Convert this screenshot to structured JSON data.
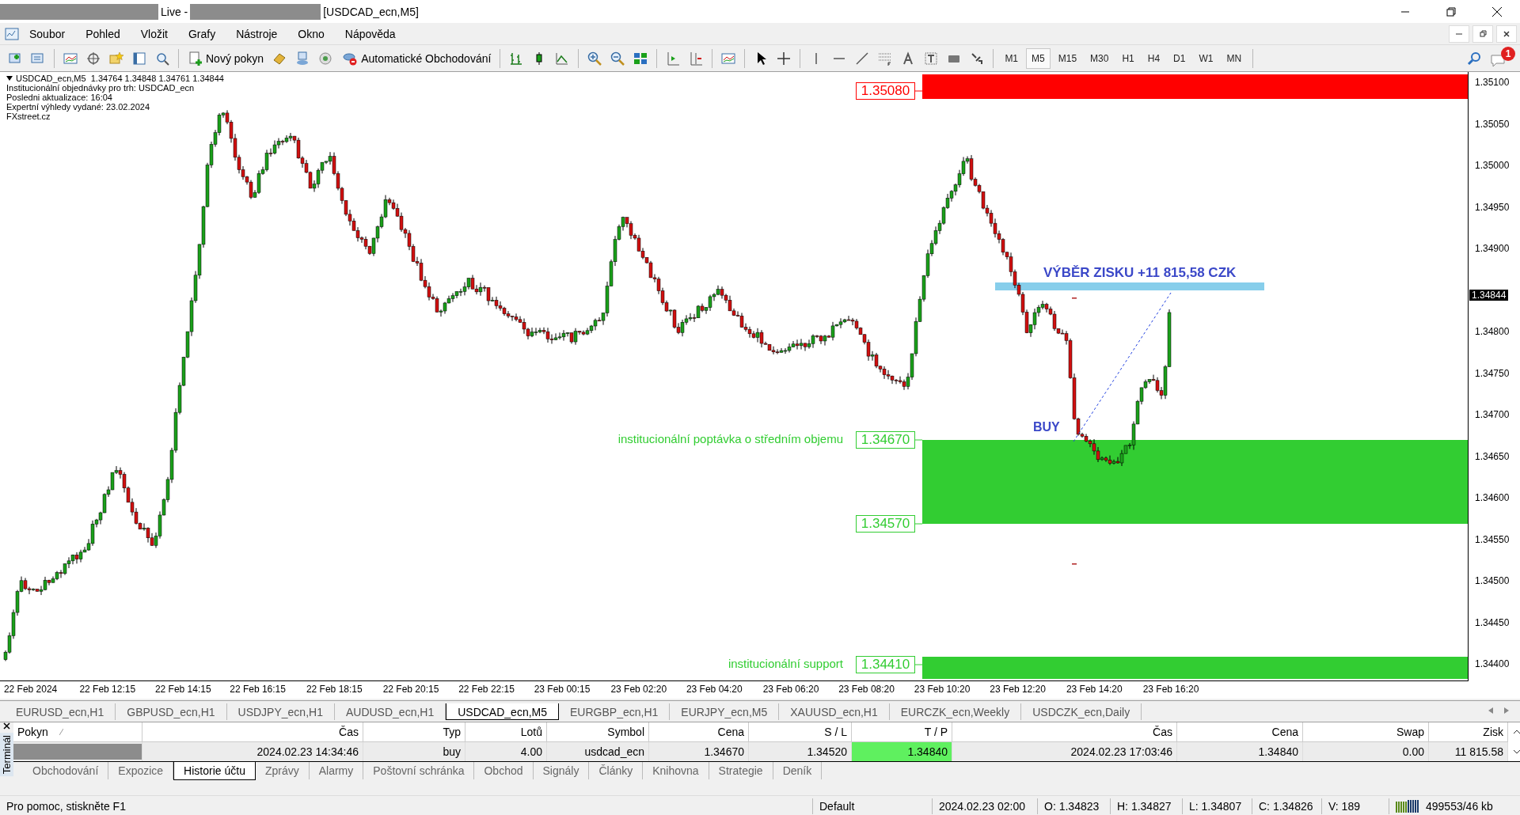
{
  "window": {
    "title_mid": "Live -",
    "title_end": "[USDCAD_ecn,M5]"
  },
  "menu": [
    "Soubor",
    "Pohled",
    "Vložit",
    "Grafy",
    "Nástroje",
    "Okno",
    "Nápověda"
  ],
  "toolbar": {
    "new_order": "Nový pokyn",
    "autotrading": "Automatické Obchodování",
    "timeframes": [
      {
        "label": "M1",
        "selected": false
      },
      {
        "label": "M5",
        "selected": true
      },
      {
        "label": "M15",
        "selected": false
      },
      {
        "label": "M30",
        "selected": false
      },
      {
        "label": "H1",
        "selected": false
      },
      {
        "label": "H4",
        "selected": false
      },
      {
        "label": "D1",
        "selected": false
      },
      {
        "label": "W1",
        "selected": false
      },
      {
        "label": "MN",
        "selected": false
      }
    ],
    "badge": "1"
  },
  "chart": {
    "header": [
      "USDCAD_ecn,M5  1.34764 1.34848 1.34761 1.34844",
      "Institucionální objednávky pro trh: USDCAD_ecn",
      "Posledni aktualizace: 16:04",
      "Expertní výhledy vydané: 23.02.2024",
      "FXstreet.cz"
    ],
    "zones": [
      {
        "color": "#ff0000",
        "levels": [
          {
            "label": "1.35080"
          }
        ]
      },
      {
        "color": "#32cd32",
        "levels": [
          {
            "label": "1.34670",
            "note": "institucionální poptávka o středním objemu"
          },
          {
            "label": "1.34570"
          }
        ]
      },
      {
        "color": "#32cd32",
        "levels": [
          {
            "label": "1.34410",
            "note": "institucionální support"
          }
        ]
      }
    ],
    "profit_label": "VÝBĚR ZISKU +11 815,58 CZK",
    "buy_label": "BUY",
    "price_axis": [
      "1.35100",
      "1.35050",
      "1.35000",
      "1.34950",
      "1.34900",
      "1.34800",
      "1.34750",
      "1.34700",
      "1.34650",
      "1.34600",
      "1.34550",
      "1.34500",
      "1.34450",
      "1.34400"
    ],
    "current_price": "1.34844",
    "time_axis": [
      "22 Feb 2024",
      "22 Feb 12:15",
      "22 Feb 14:15",
      "22 Feb 16:15",
      "22 Feb 18:15",
      "22 Feb 20:15",
      "22 Feb 22:15",
      "23 Feb 00:15",
      "23 Feb 02:20",
      "23 Feb 04:20",
      "23 Feb 06:20",
      "23 Feb 08:20",
      "23 Feb 10:20",
      "23 Feb 12:20",
      "23 Feb 14:20",
      "23 Feb 16:20"
    ]
  },
  "chart_tabs": [
    {
      "label": "EURUSD_ecn,H1",
      "selected": false
    },
    {
      "label": "GBPUSD_ecn,H1",
      "selected": false
    },
    {
      "label": "USDJPY_ecn,H1",
      "selected": false
    },
    {
      "label": "AUDUSD_ecn,H1",
      "selected": false
    },
    {
      "label": "USDCAD_ecn,M5",
      "selected": true
    },
    {
      "label": "EURGBP_ecn,H1",
      "selected": false
    },
    {
      "label": "EURJPY_ecn,M5",
      "selected": false
    },
    {
      "label": "XAUUSD_ecn,H1",
      "selected": false
    },
    {
      "label": "EURCZK_ecn,Weekly",
      "selected": false
    },
    {
      "label": "USDCZK_ecn,Daily",
      "selected": false
    }
  ],
  "terminal": {
    "side_label": "Terminál",
    "columns": [
      "Pokyn",
      "Čas",
      "Typ",
      "Lotů",
      "Symbol",
      "Cena",
      "S / L",
      "T / P",
      "Čas",
      "Cena",
      "Swap",
      "Zisk"
    ],
    "rows": [
      {
        "cells": [
          "",
          "2024.02.23 14:34:46",
          "buy",
          "4.00",
          "usdcad_ecn",
          "1.34670",
          "1.34520",
          "1.34840",
          "2024.02.23 17:03:46",
          "1.34840",
          "0.00",
          "11 815.58"
        ],
        "tp_reached": true
      }
    ],
    "tabs": [
      {
        "label": "Obchodování",
        "selected": false
      },
      {
        "label": "Expozice",
        "selected": false
      },
      {
        "label": "Historie účtu",
        "selected": true
      },
      {
        "label": "Zprávy",
        "selected": false
      },
      {
        "label": "Alarmy",
        "selected": false
      },
      {
        "label": "Poštovní schránka",
        "selected": false
      },
      {
        "label": "Obchod",
        "selected": false
      },
      {
        "label": "Signály",
        "selected": false
      },
      {
        "label": "Články",
        "selected": false
      },
      {
        "label": "Knihovna",
        "selected": false
      },
      {
        "label": "Strategie",
        "selected": false
      },
      {
        "label": "Deník",
        "selected": false
      }
    ]
  },
  "status_bar": {
    "help": "Pro pomoc, stiskněte F1",
    "profile": "Default",
    "datetime": "2024.02.23 02:00",
    "open": "O: 1.34823",
    "high": "H: 1.34827",
    "low": "L: 1.34807",
    "close": "C: 1.34826",
    "volume": "V: 189",
    "traffic": "499553/46 kb"
  }
}
